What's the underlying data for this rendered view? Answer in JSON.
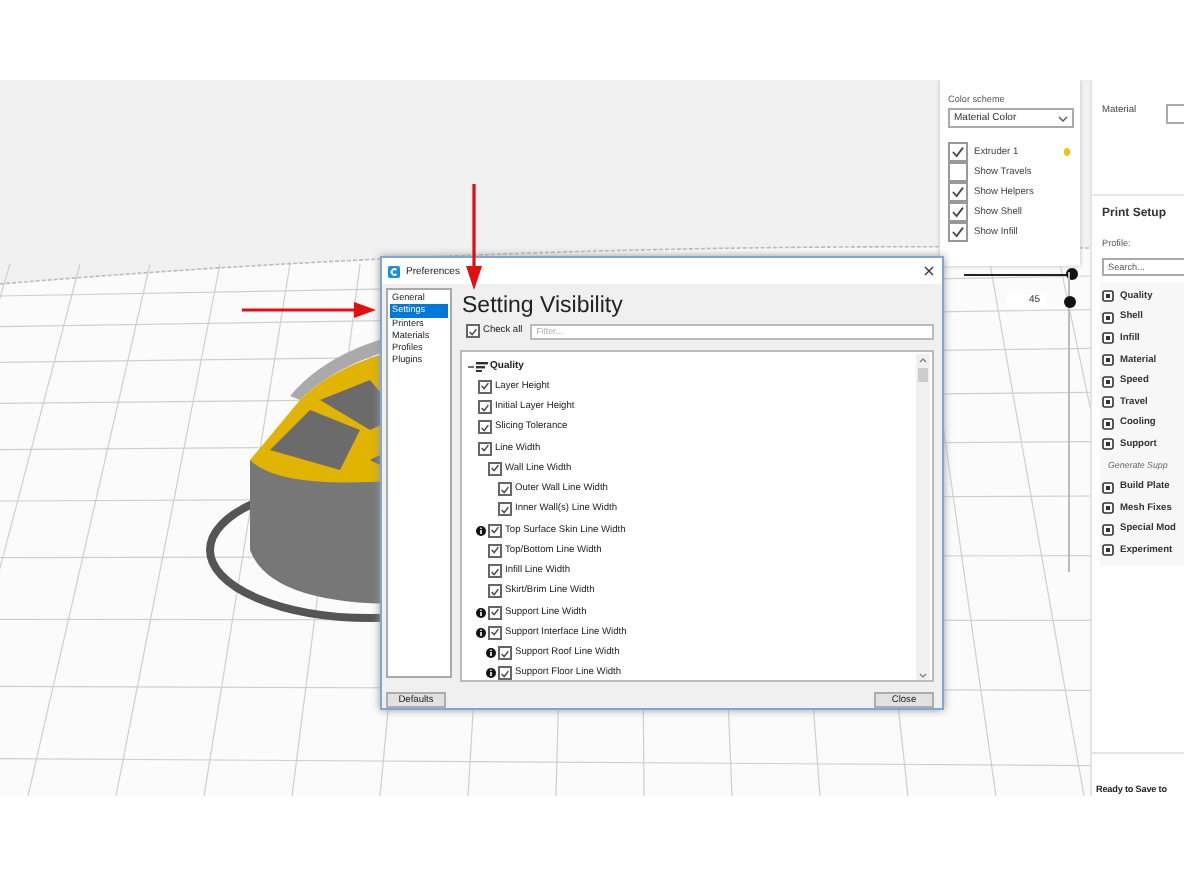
{
  "viewport_panel": {
    "color_scheme_label": "Color scheme",
    "color_scheme": "Material Color",
    "layers": [
      {
        "label": "Extruder 1",
        "checked": true,
        "color": "#f2c21b"
      },
      {
        "label": "Show Travels",
        "checked": false
      },
      {
        "label": "Show Helpers",
        "checked": true
      },
      {
        "label": "Show Shell",
        "checked": true
      },
      {
        "label": "Show Infill",
        "checked": true
      }
    ]
  },
  "layer_view": {
    "opacity_slider": {
      "level": 1
    },
    "layer_slider": {
      "level": 0.9,
      "value": "45"
    }
  },
  "sidebar": {
    "material_label": "Material",
    "title": "Print Setup",
    "profile_label": "Profile:",
    "search": {
      "placeholder": "Search..."
    },
    "categories": [
      {
        "label": "Quality",
        "kind": "category"
      },
      {
        "label": "Shell",
        "kind": "category"
      },
      {
        "label": "Infill",
        "kind": "category"
      },
      {
        "label": "Material",
        "kind": "category"
      },
      {
        "label": "Speed",
        "kind": "category"
      },
      {
        "label": "Travel",
        "kind": "category"
      },
      {
        "label": "Cooling",
        "kind": "category"
      },
      {
        "label": "Support",
        "kind": "category"
      },
      {
        "label": "Generate Supp",
        "kind": "setting"
      },
      {
        "label": "Build Plate",
        "kind": "category"
      },
      {
        "label": "Mesh Fixes",
        "kind": "category"
      },
      {
        "label": "Special Mod",
        "kind": "category"
      },
      {
        "label": "Experiment",
        "kind": "category"
      }
    ],
    "status": "Ready to Save to"
  },
  "dialog": {
    "title": "Preferences",
    "pages": [
      {
        "label": "General",
        "selected": false
      },
      {
        "label": "Settings",
        "selected": true
      },
      {
        "label": "Printers",
        "selected": false
      },
      {
        "label": "Materials",
        "selected": false
      },
      {
        "label": "Profiles",
        "selected": false
      },
      {
        "label": "Plugins",
        "selected": false
      }
    ],
    "heading": "Setting Visibility",
    "check_all": {
      "label": "Check all",
      "checked": true
    },
    "filter": {
      "placeholder": "Filter..."
    },
    "settings": [
      {
        "label": "Quality",
        "kind": "category",
        "expanded": true,
        "children": [
          {
            "label": "Layer Height",
            "checked": true,
            "info": false
          },
          {
            "label": "Initial Layer Height",
            "checked": true,
            "info": false
          },
          {
            "label": "Slicing Tolerance",
            "checked": true,
            "info": false
          },
          {
            "label": "Line Width",
            "checked": true,
            "info": false,
            "children": [
              {
                "label": "Wall Line Width",
                "checked": true,
                "info": false,
                "children": [
                  {
                    "label": "Outer Wall Line Width",
                    "checked": true,
                    "info": false
                  },
                  {
                    "label": "Inner Wall(s) Line Width",
                    "checked": true,
                    "info": false
                  }
                ]
              },
              {
                "label": "Top Surface Skin Line Width",
                "checked": true,
                "info": true
              },
              {
                "label": "Top/Bottom Line Width",
                "checked": true,
                "info": false
              },
              {
                "label": "Infill Line Width",
                "checked": true,
                "info": false
              },
              {
                "label": "Skirt/Brim Line Width",
                "checked": true,
                "info": false
              },
              {
                "label": "Support Line Width",
                "checked": true,
                "info": true
              },
              {
                "label": "Support Interface Line Width",
                "checked": true,
                "info": true,
                "children": [
                  {
                    "label": "Support Roof Line Width",
                    "checked": true,
                    "info": true
                  },
                  {
                    "label": "Support Floor Line Width",
                    "checked": true,
                    "info": true
                  }
                ]
              }
            ]
          }
        ]
      }
    ],
    "buttons": [
      "Defaults",
      "Close"
    ]
  }
}
